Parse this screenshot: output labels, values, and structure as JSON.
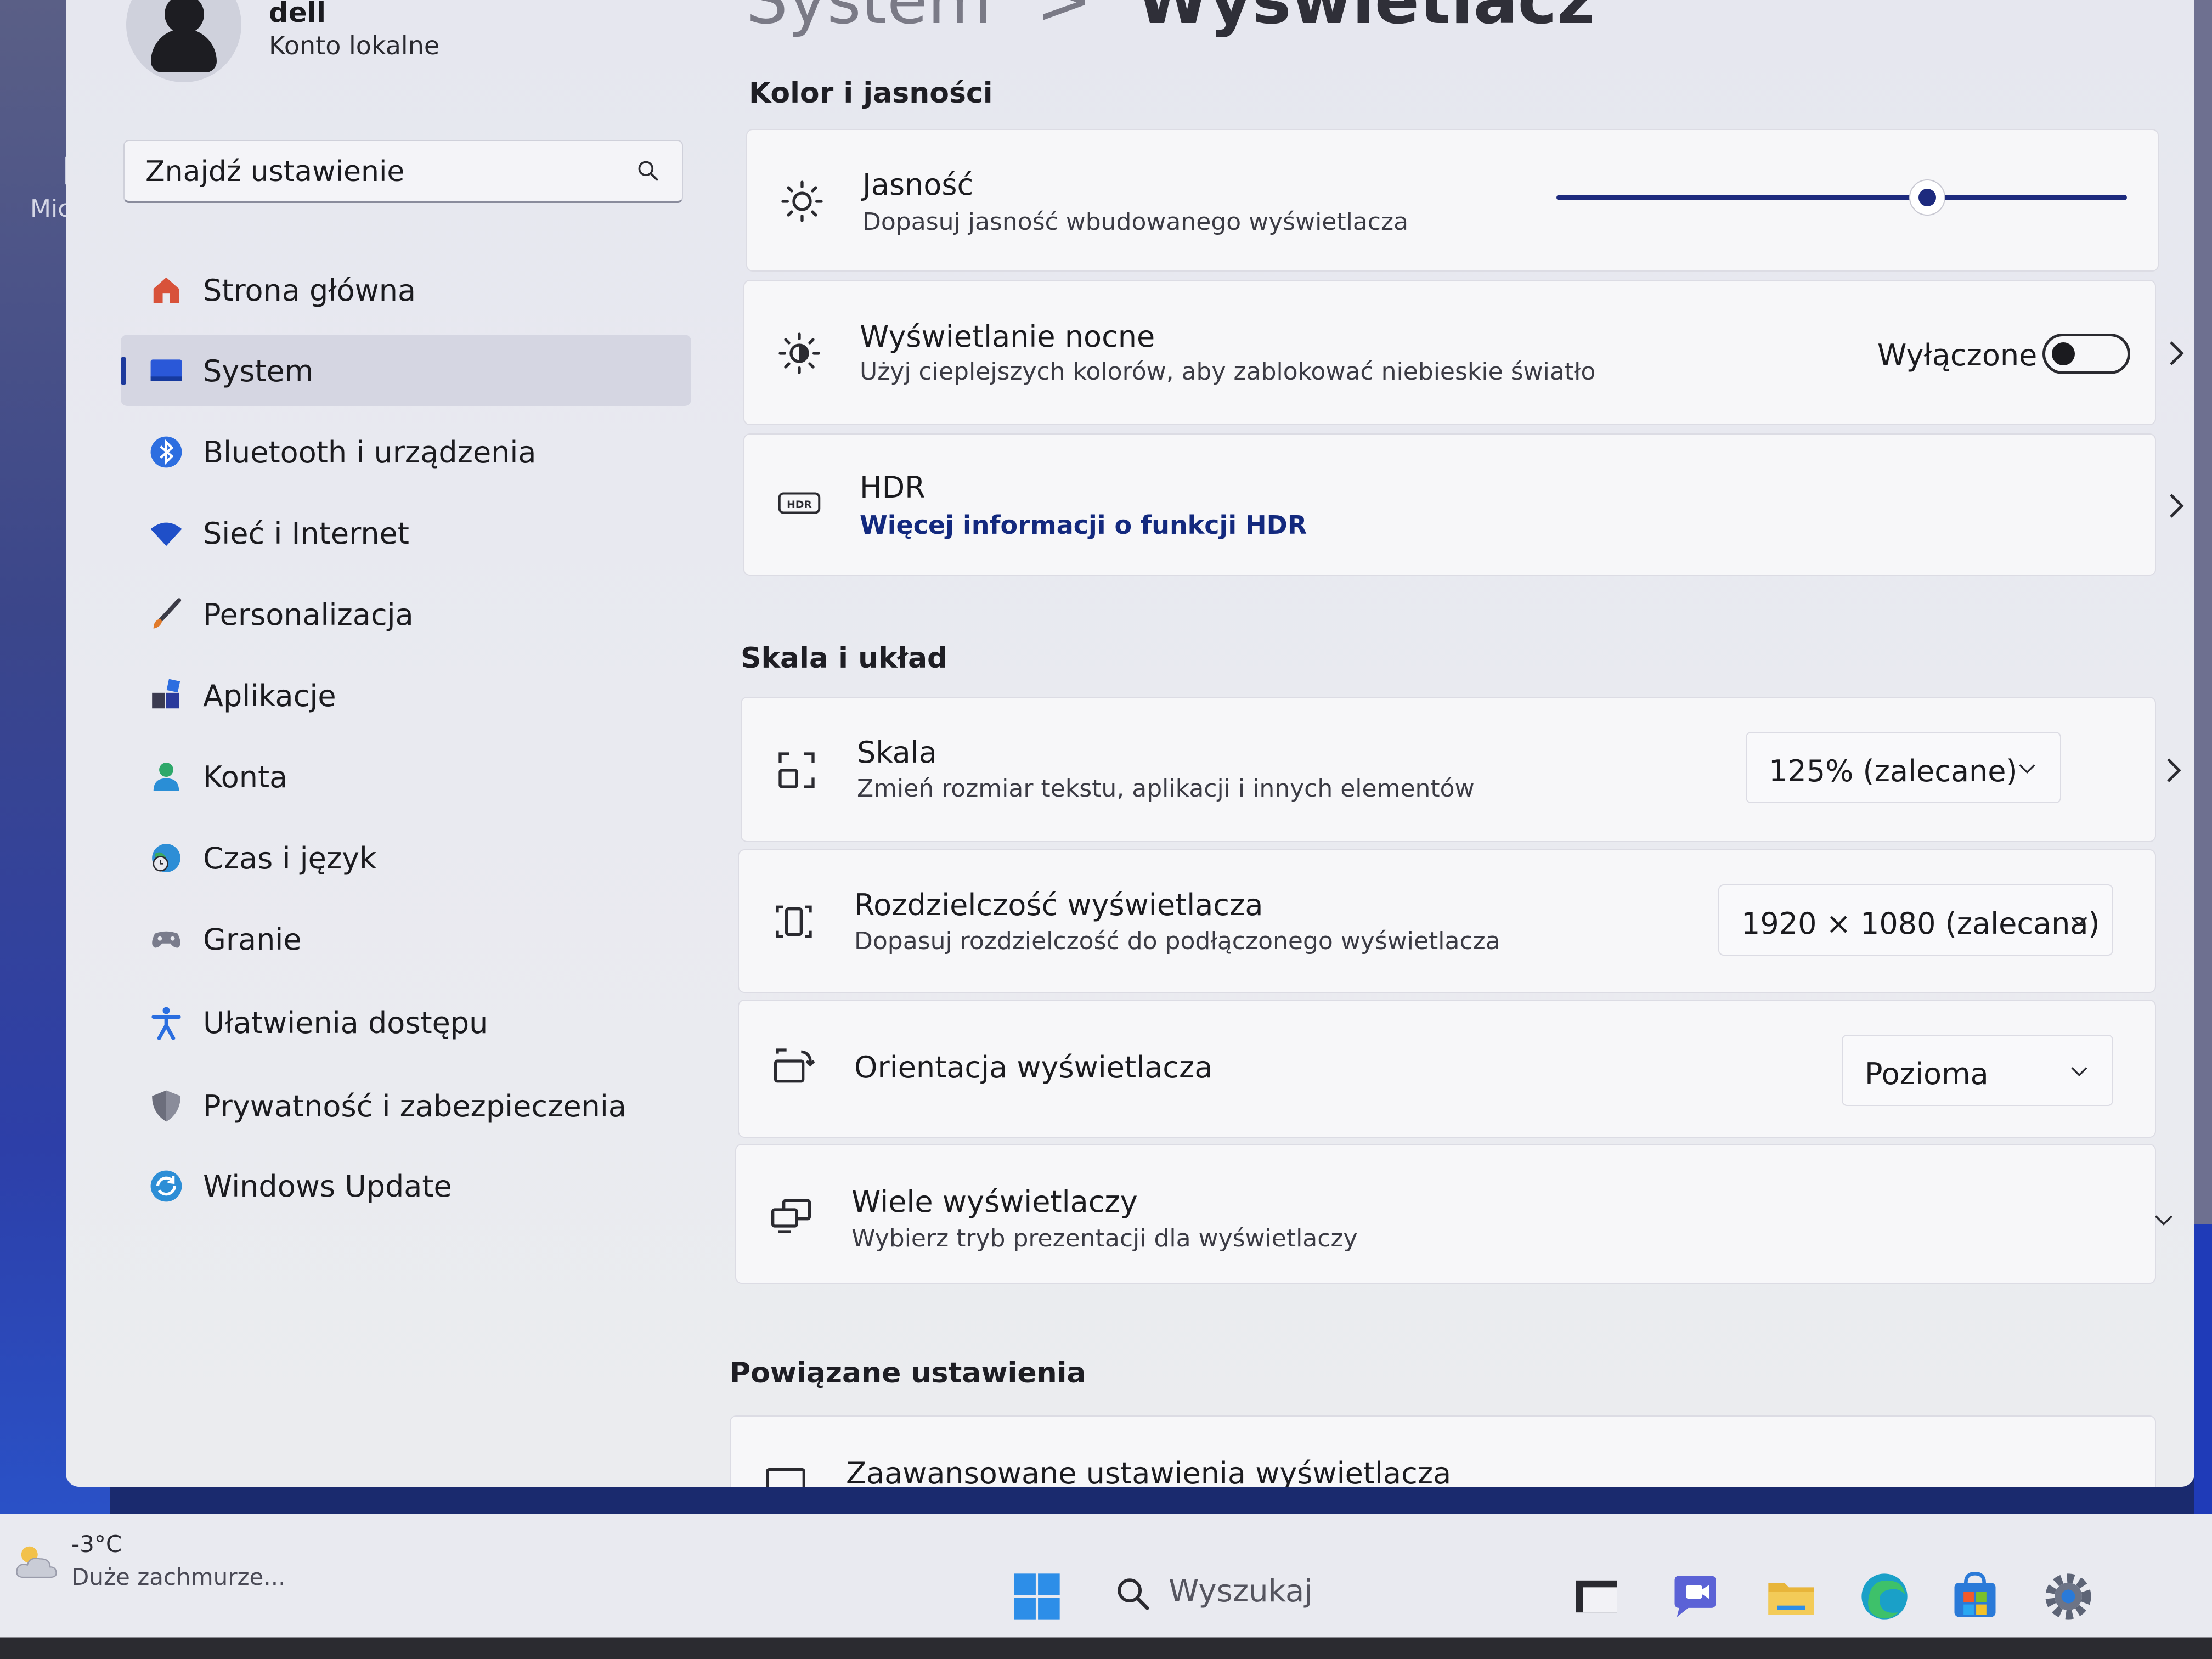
{
  "desktop": {
    "icon_label": "Micro"
  },
  "breadcrumb": {
    "parent": "System",
    "separator": ">",
    "current": "Wyświetlacz"
  },
  "account": {
    "name": "dell",
    "type": "Konto lokalne"
  },
  "search": {
    "placeholder": "Znajdź ustawienie"
  },
  "sidebar": {
    "items": [
      {
        "label": "Strona główna",
        "icon": "home-icon",
        "active": false
      },
      {
        "label": "System",
        "icon": "system-icon",
        "active": true
      },
      {
        "label": "Bluetooth i urządzenia",
        "icon": "bluetooth-icon",
        "active": false
      },
      {
        "label": "Sieć i Internet",
        "icon": "wifi-icon",
        "active": false
      },
      {
        "label": "Personalizacja",
        "icon": "brush-icon",
        "active": false
      },
      {
        "label": "Aplikacje",
        "icon": "apps-icon",
        "active": false
      },
      {
        "label": "Konta",
        "icon": "person-icon",
        "active": false
      },
      {
        "label": "Czas i język",
        "icon": "globe-clock-icon",
        "active": false
      },
      {
        "label": "Granie",
        "icon": "gamepad-icon",
        "active": false
      },
      {
        "label": "Ułatwienia dostępu",
        "icon": "accessibility-icon",
        "active": false
      },
      {
        "label": "Prywatność i zabezpieczenia",
        "icon": "shield-icon",
        "active": false
      },
      {
        "label": "Windows Update",
        "icon": "update-icon",
        "active": false
      }
    ]
  },
  "sections": {
    "color": {
      "header": "Kolor i jasności",
      "brightness": {
        "title": "Jasność",
        "subtitle": "Dopasuj jasność wbudowanego wyświetlacza",
        "value_percent": 65
      },
      "night_light": {
        "title": "Wyświetlanie nocne",
        "subtitle": "Użyj cieplejszych kolorów, aby zablokować niebieskie światło",
        "status": "Wyłączone",
        "on": false
      },
      "hdr": {
        "title": "HDR",
        "link": "Więcej informacji o funkcji HDR"
      }
    },
    "scale": {
      "header": "Skala i układ",
      "scale": {
        "title": "Skala",
        "subtitle": "Zmień rozmiar tekstu, aplikacji i innych elementów",
        "value": "125% (zalecane)"
      },
      "resolution": {
        "title": "Rozdzielczość wyświetlacza",
        "subtitle": "Dopasuj rozdzielczość do podłączonego wyświetlacza",
        "value": "1920 × 1080 (zalecana)"
      },
      "orientation": {
        "title": "Orientacja wyświetlacza",
        "value": "Pozioma"
      },
      "multi": {
        "title": "Wiele wyświetlaczy",
        "subtitle": "Wybierz tryb prezentacji dla wyświetlaczy"
      }
    },
    "related": {
      "header": "Powiązane ustawienia",
      "advanced": {
        "title": "Zaawansowane ustawienia wyświetlacza"
      }
    }
  },
  "taskbar": {
    "weather": {
      "temp": "-3°C",
      "desc": "Duże zachmurze..."
    },
    "search_label": "Wyszukaj"
  },
  "colors": {
    "accent": "#1d2a7e",
    "link": "#13297e"
  }
}
